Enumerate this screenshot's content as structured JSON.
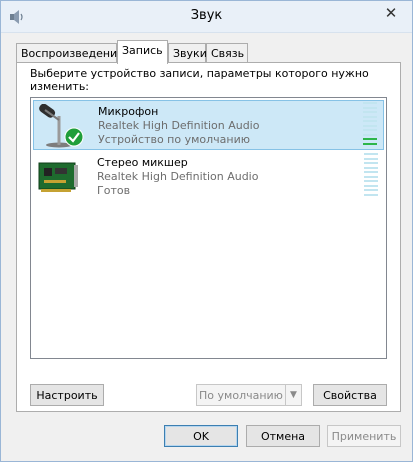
{
  "window": {
    "title": "Звук",
    "close_glyph": "✕"
  },
  "tabs": [
    {
      "label": "Воспроизведение"
    },
    {
      "label": "Запись"
    },
    {
      "label": "Звуки"
    },
    {
      "label": "Связь"
    }
  ],
  "panel": {
    "prompt": "Выберите устройство записи, параметры которого нужно изменить:"
  },
  "devices": [
    {
      "name": "Микрофон",
      "driver": "Realtek High Definition Audio",
      "status": "Устройство по умолчанию",
      "icon": "microphone-icon",
      "selected": true,
      "level_fraction": 0.15
    },
    {
      "name": "Стерео микшер",
      "driver": "Realtek High Definition Audio",
      "status": "Готов",
      "icon": "sound-card-icon",
      "selected": false,
      "level_fraction": 0
    }
  ],
  "buttons": {
    "configure": "Настроить",
    "set_default": "По умолчанию",
    "properties": "Свойства",
    "ok": "OK",
    "cancel": "Отмена",
    "apply": "Применить"
  },
  "colors": {
    "selection_bg": "#cde8f7",
    "meter_green": "#2db54a",
    "meter_empty": "#c2e5f0"
  }
}
